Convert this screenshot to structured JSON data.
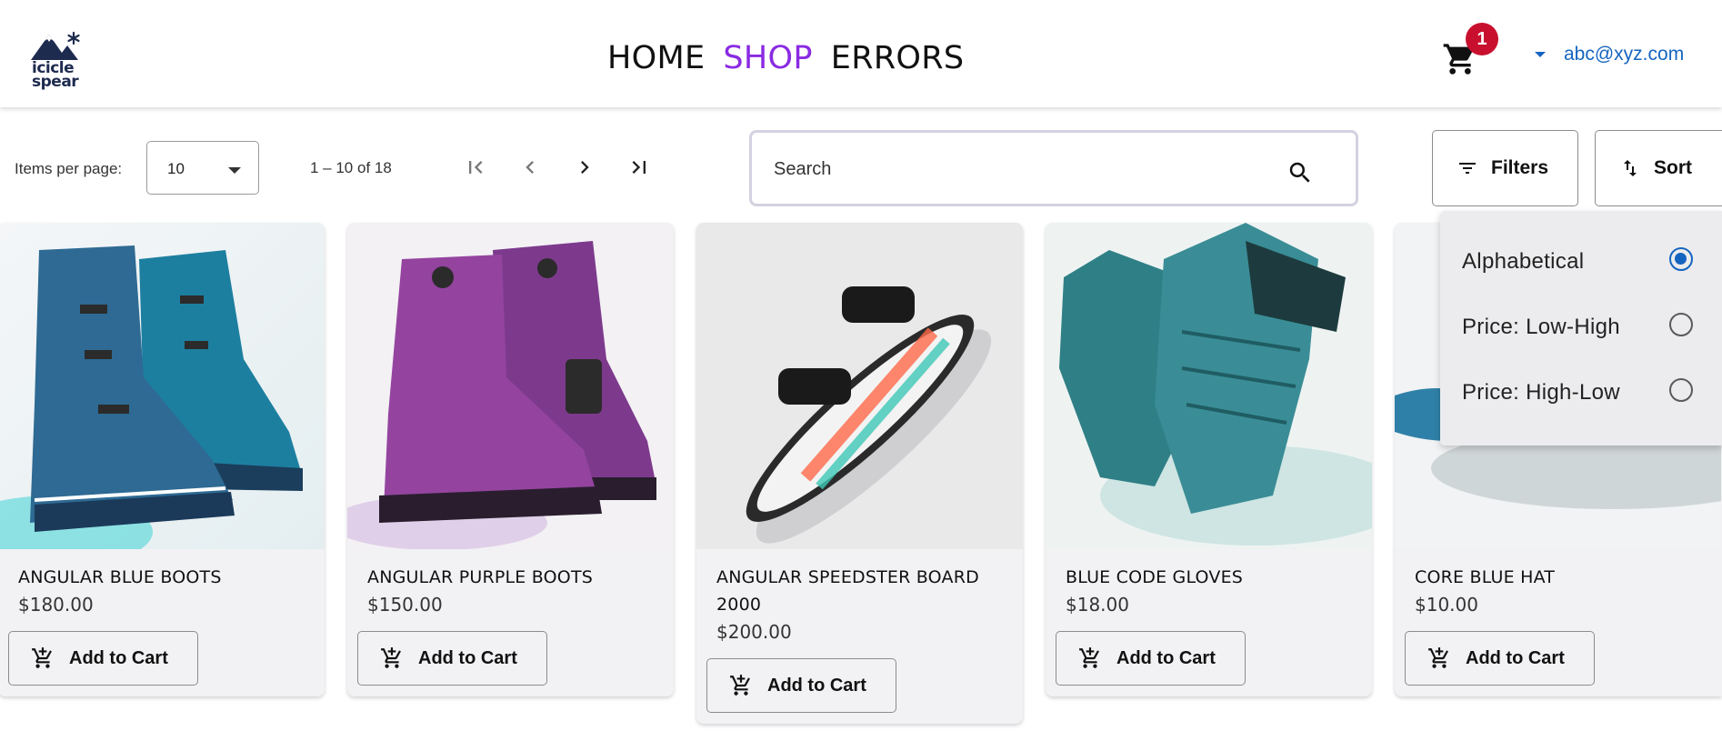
{
  "brand": {
    "logo_line1": "icicle",
    "logo_line2": "spear"
  },
  "nav": {
    "home": "HOME",
    "shop": "SHOP",
    "errors": "ERRORS",
    "active": "SHOP",
    "active_color": "#8a2be2"
  },
  "cart": {
    "count": "1",
    "icon": "shopping-cart-icon",
    "badge_color": "#c8102e"
  },
  "user": {
    "email": "abc@xyz.com",
    "color": "#1565c0"
  },
  "pagination": {
    "items_per_page_label": "Items per page:",
    "items_per_page_value": "10",
    "range_label": "1 – 10 of 18",
    "icons": [
      "first-page-icon",
      "previous-page-icon",
      "next-page-icon",
      "last-page-icon"
    ]
  },
  "search": {
    "placeholder": "Search",
    "icon": "search-icon"
  },
  "toolbar": {
    "filters_label": "Filters",
    "sort_label": "Sort"
  },
  "sort_menu": {
    "options": [
      "Alphabetical",
      "Price: Low-High",
      "Price: High-Low"
    ],
    "selected": "Alphabetical"
  },
  "products": [
    {
      "name": "ANGULAR BLUE BOOTS",
      "price": "$180.00",
      "image": "blue snowboard boots"
    },
    {
      "name": "ANGULAR PURPLE BOOTS",
      "price": "$150.00",
      "image": "purple snowboard boots"
    },
    {
      "name": "ANGULAR SPEEDSTER BOARD 2000",
      "price": "$200.00",
      "image": "snowboard with bindings"
    },
    {
      "name": "BLUE CODE GLOVES",
      "price": "$18.00",
      "image": "teal gloves"
    },
    {
      "name": "CORE BLUE HAT",
      "price": "$10.00",
      "image": "blue hat"
    }
  ],
  "add_to_cart_label": "Add to Cart"
}
